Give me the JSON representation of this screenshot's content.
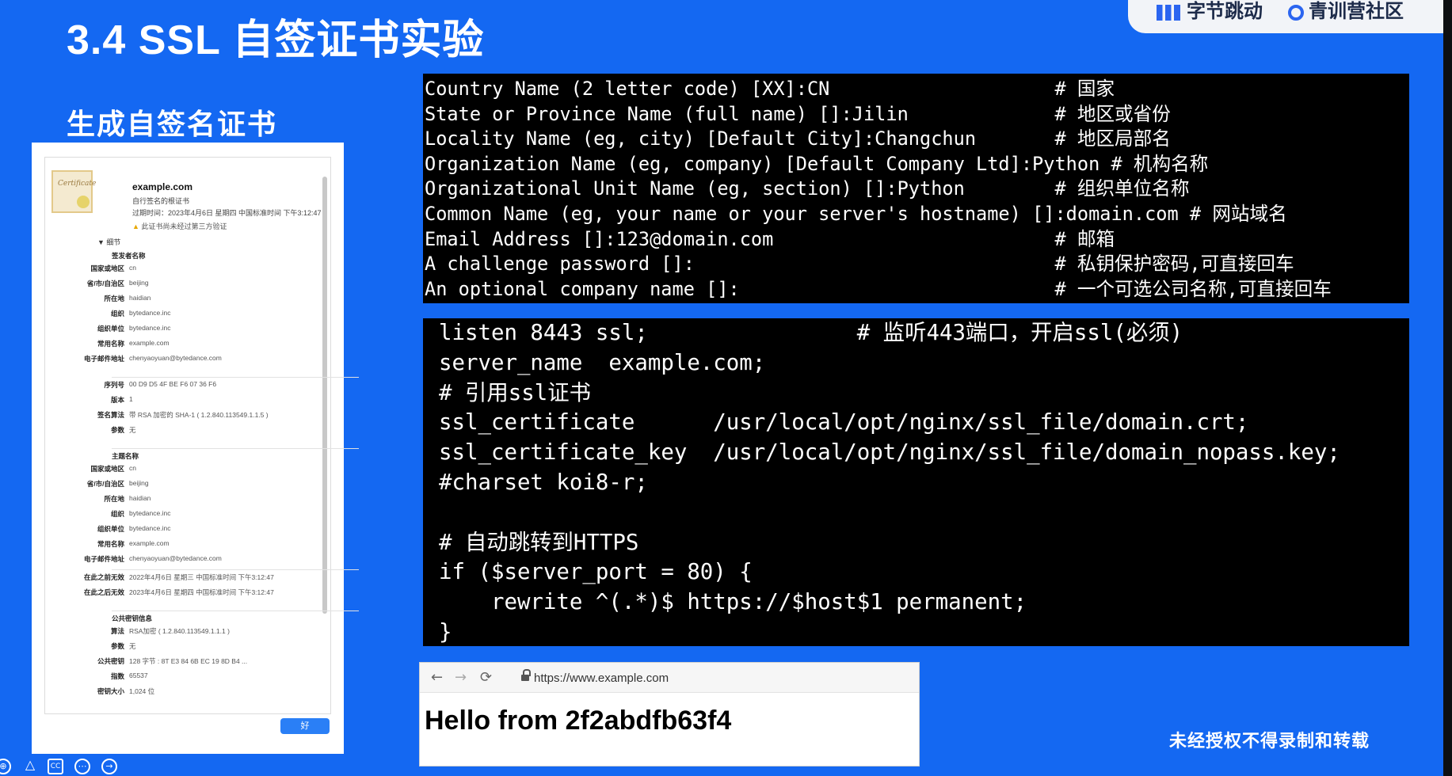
{
  "slide": {
    "title": "3.4 SSL 自签证书实验",
    "subtitle": "生成自签名证书",
    "watermark": "未经授权不得录制和转载"
  },
  "logos": {
    "left": "字节跳动",
    "right": "青训营社区"
  },
  "certificate": {
    "domain": "example.com",
    "line1": "自行签名的根证书",
    "line2": "过期时间：2023年4月6日 星期四 中国标准时间 下午3:12:47",
    "warning": "此证书尚未经过第三方验证",
    "section_details": "细节",
    "subject_head": "签发者名称",
    "subject": [
      {
        "label": "国家或地区",
        "value": "cn"
      },
      {
        "label": "省/市/自治区",
        "value": "beijing"
      },
      {
        "label": "所在地",
        "value": "haidian"
      },
      {
        "label": "组织",
        "value": "bytedance.inc"
      },
      {
        "label": "组织单位",
        "value": "bytedance.inc"
      },
      {
        "label": "常用名称",
        "value": "example.com"
      },
      {
        "label": "电子邮件地址",
        "value": "chenyaoyuan@bytedance.com"
      }
    ],
    "serial": [
      {
        "label": "序列号",
        "value": "00 D9 D5 4F BE F6 07 36 F6"
      },
      {
        "label": "版本",
        "value": "1"
      },
      {
        "label": "签名算法",
        "value": "带 RSA 加密的 SHA-1 ( 1.2.840.113549.1.1.5 )"
      },
      {
        "label": "参数",
        "value": "无"
      }
    ],
    "issuer_head": "主题名称",
    "issuer": [
      {
        "label": "国家或地区",
        "value": "cn"
      },
      {
        "label": "省/市/自治区",
        "value": "beijing"
      },
      {
        "label": "所在地",
        "value": "haidian"
      },
      {
        "label": "组织",
        "value": "bytedance.inc"
      },
      {
        "label": "组织单位",
        "value": "bytedance.inc"
      },
      {
        "label": "常用名称",
        "value": "example.com"
      },
      {
        "label": "电子邮件地址",
        "value": "chenyaoyuan@bytedance.com"
      }
    ],
    "validity": [
      {
        "label": "在此之前无效",
        "value": "2022年4月6日 星期三 中国标准时间 下午3:12:47"
      },
      {
        "label": "在此之后无效",
        "value": "2023年4月6日 星期四 中国标准时间 下午3:12:47"
      }
    ],
    "pubkey_head": "公共密钥信息",
    "pubkey": [
      {
        "label": "算法",
        "value": "RSA加密 ( 1.2.840.113549.1.1.1 )"
      },
      {
        "label": "参数",
        "value": "无"
      },
      {
        "label": "公共密钥",
        "value": "128 字节 : 8T E3 84 6B EC 19 8D B4 ..."
      },
      {
        "label": "指数",
        "value": "65537"
      },
      {
        "label": "密钥大小",
        "value": "1,024 位"
      }
    ],
    "ok_button": "好"
  },
  "terminal_openssl": {
    "lines": [
      "Country Name (2 letter code) [XX]:CN                    # 国家",
      "State or Province Name (full name) []:Jilin             # 地区或省份",
      "Locality Name (eg, city) [Default City]:Changchun       # 地区局部名",
      "Organization Name (eg, company) [Default Company Ltd]:Python # 机构名称",
      "Organizational Unit Name (eg, section) []:Python        # 组织单位名称",
      "Common Name (eg, your name or your server's hostname) []:domain.com # 网站域名",
      "Email Address []:123@domain.com                         # 邮箱",
      "A challenge password []:                                # 私钥保护密码,可直接回车",
      "An optional company name []:                            # 一个可选公司名称,可直接回车"
    ]
  },
  "terminal_nginx": {
    "lines": [
      "listen 8443 ssl;                # 监听443端口，开启ssl(必须)",
      "server_name  example.com;",
      "# 引用ssl证书",
      "ssl_certificate      /usr/local/opt/nginx/ssl_file/domain.crt;",
      "ssl_certificate_key  /usr/local/opt/nginx/ssl_file/domain_nopass.key;",
      "#charset koi8-r;",
      "",
      "# 自动跳转到HTTPS",
      "if ($server_port = 80) {",
      "    rewrite ^(.*)$ https://$host$1 permanent;",
      "}"
    ]
  },
  "browser": {
    "url": "https://www.example.com",
    "body_text": "Hello from 2f2abdfb63f4"
  },
  "controls": {
    "labels": [
      "⊕",
      "△",
      "CC",
      "⋯",
      "→"
    ]
  }
}
